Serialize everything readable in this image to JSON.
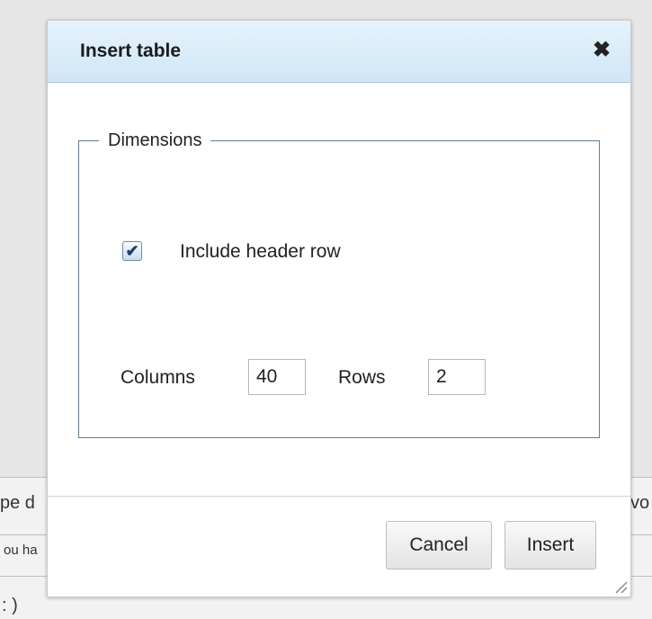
{
  "background": {
    "fragments": [
      {
        "id": "frag1",
        "text": "pe d"
      },
      {
        "id": "frag2",
        "text": "ou ha"
      },
      {
        "id": "frag3",
        "text": ": )"
      },
      {
        "id": "frag4",
        "text": "vo"
      }
    ]
  },
  "dialog": {
    "title": "Insert table",
    "close_glyph": "✖",
    "fieldset_legend": "Dimensions",
    "include_header": {
      "label": "Include header row",
      "checked": true,
      "check_glyph": "✔"
    },
    "columns": {
      "label": "Columns",
      "value": "40"
    },
    "rows": {
      "label": "Rows",
      "value": "2"
    },
    "buttons": {
      "cancel": "Cancel",
      "insert": "Insert"
    }
  },
  "colors": {
    "titlebar": "#d6eaf8",
    "fieldset_border": "#5d7f98"
  },
  "icons": {
    "close": "close-icon",
    "checkbox": "checkmark-icon",
    "resize": "resize-grip-icon"
  }
}
